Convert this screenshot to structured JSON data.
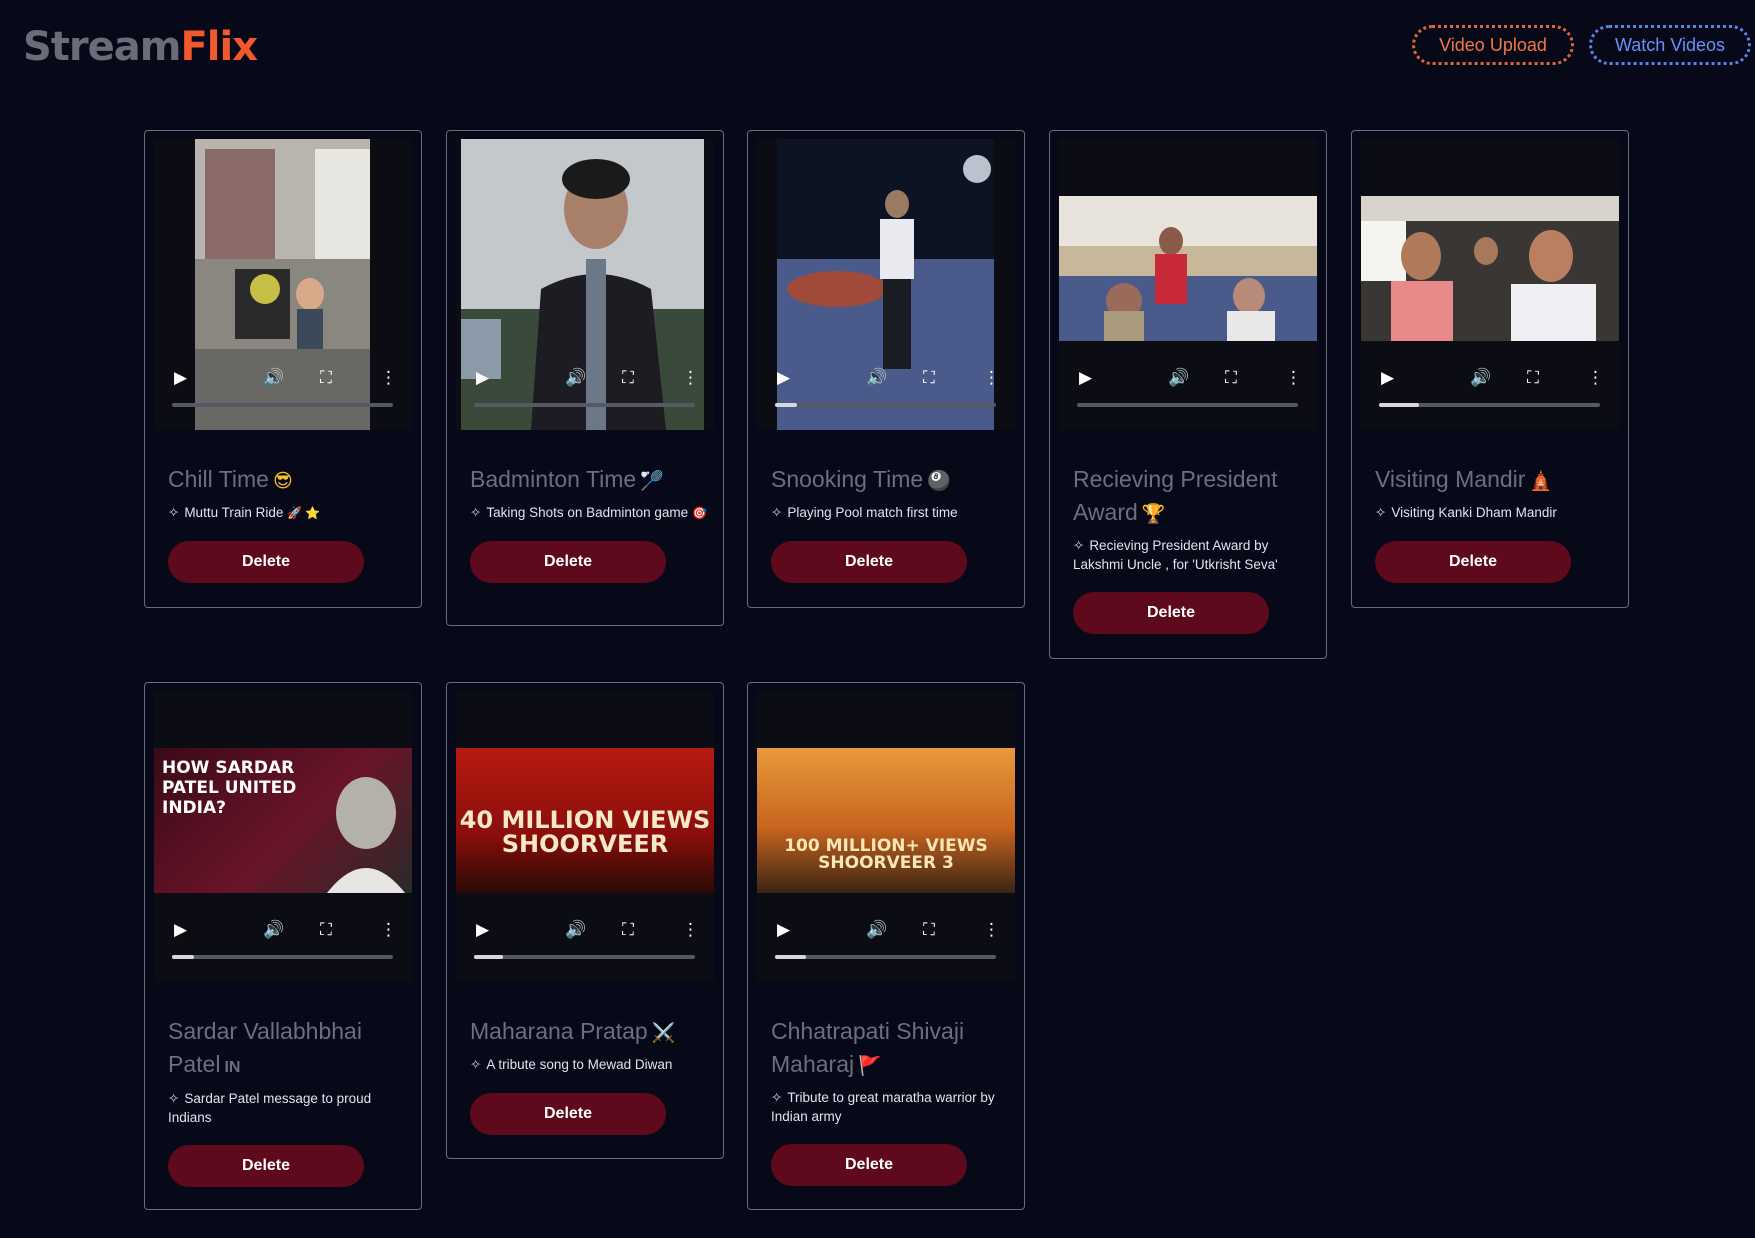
{
  "brand": {
    "part1": "Stream",
    "part2": "Flix",
    "color1": "#6a6c78",
    "color2": "#f0582e"
  },
  "nav": {
    "upload_label": "Video Upload",
    "watch_label": "Watch Videos"
  },
  "video_controls": {
    "play_icon": "▶",
    "volume_icon": "🔊",
    "fullscreen_icon": "⛶",
    "more_icon": "⋮"
  },
  "cards": [
    {
      "title": "Chill Time",
      "emoji": "😎",
      "desc": "Muttu Train Ride",
      "desc_emoji": "🚀 ⭐",
      "progress": 0,
      "thumb_text": "",
      "delete_label": "Delete"
    },
    {
      "title": "Badminton Time",
      "emoji": "🏸",
      "desc": "Taking Shots on Badminton game",
      "desc_emoji": "🎯",
      "progress": 0,
      "thumb_text": "",
      "delete_label": "Delete"
    },
    {
      "title": "Snooking Time",
      "emoji": "🎱",
      "desc": "Playing Pool match first time",
      "desc_emoji": "",
      "progress": 0.1,
      "thumb_text": "",
      "delete_label": "Delete"
    },
    {
      "title": "Recieving President Award",
      "emoji": "🏆",
      "desc": "Recieving President Award by Lakshmi Uncle , for 'Utkrisht Seva'",
      "desc_emoji": "",
      "progress": 0,
      "thumb_text": "",
      "delete_label": "Delete"
    },
    {
      "title": "Visiting Mandir",
      "emoji": "🛕",
      "desc": "Visiting Kanki Dham Mandir",
      "desc_emoji": "",
      "progress": 0.18,
      "thumb_text": "",
      "delete_label": "Delete"
    },
    {
      "title": "Sardar Vallabhbhai Patel",
      "emoji": "IN",
      "desc": "Sardar Patel message to proud Indians",
      "desc_emoji": "",
      "progress": 0.1,
      "thumb_text": "HOW SARDAR PATEL UNITED INDIA?",
      "delete_label": "Delete"
    },
    {
      "title": "Maharana Pratap",
      "emoji": "⚔️",
      "desc": "A tribute song to Mewad Diwan",
      "desc_emoji": "",
      "progress": 0.13,
      "thumb_text": "40 MILLION VIEWS SHOORVEER",
      "delete_label": "Delete"
    },
    {
      "title": "Chhatrapati Shivaji Maharaj",
      "emoji": "🚩",
      "desc": "Tribute to great maratha warrior by Indian army",
      "desc_emoji": "",
      "progress": 0.14,
      "thumb_text": "100 MILLION+ VIEWS SHOORVEER 3",
      "delete_label": "Delete"
    }
  ]
}
